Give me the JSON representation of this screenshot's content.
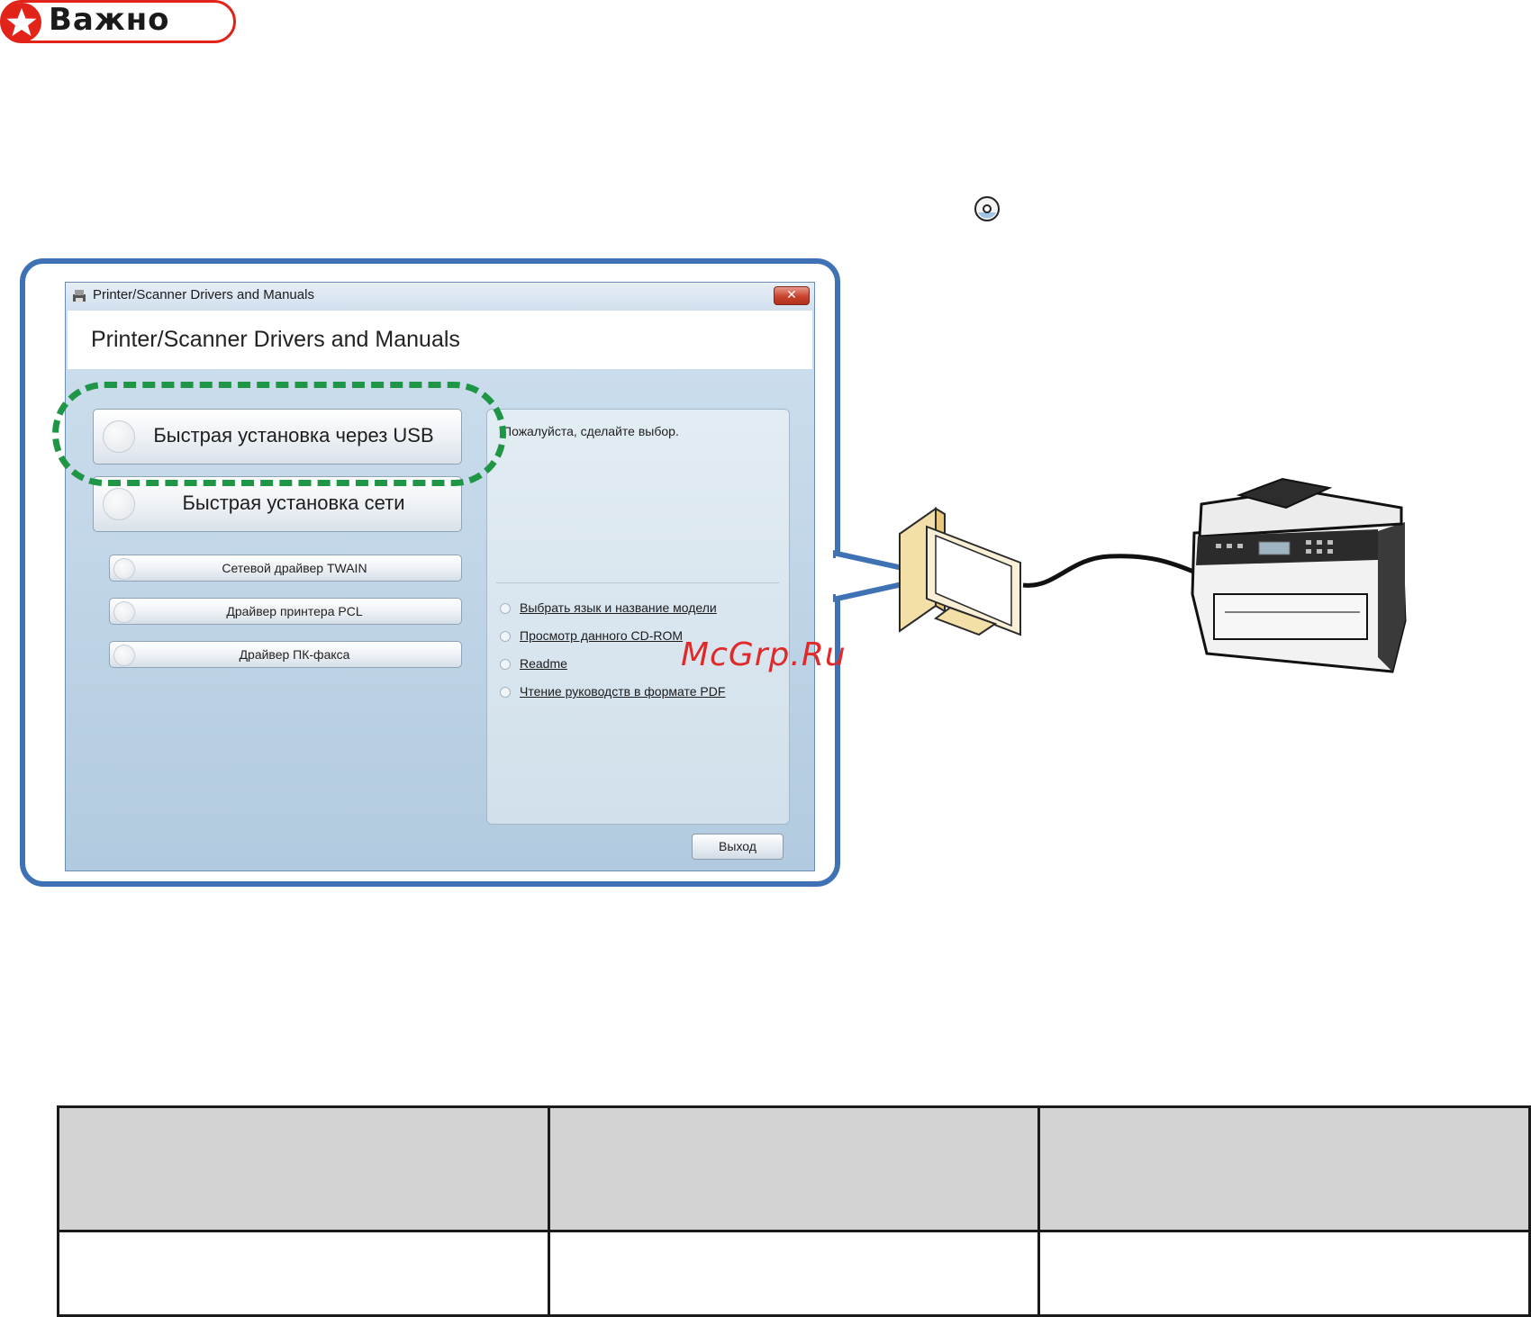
{
  "badge": {
    "label": "Важно"
  },
  "dialog": {
    "window_title": "Printer/Scanner Drivers and Manuals",
    "header_title": "Printer/Scanner Drivers and Manuals",
    "buttons": {
      "quick_usb": "Быстрая установка через USB",
      "quick_network": "Быстрая установка сети",
      "twain": "Сетевой драйвер TWAIN",
      "pcl": "Драйвер принтера PCL",
      "pc_fax": "Драйвер ПК-факса",
      "exit": "Выход"
    },
    "prompt": "Пожалуйста, сделайте выбор.",
    "links": [
      "Выбрать язык и название модели",
      "Просмотр данного CD-ROM",
      "Readme",
      "Чтение руководств в формате PDF"
    ]
  },
  "watermark": "McGrp.Ru",
  "colors": {
    "badge_red": "#e2231a",
    "callout_blue": "#3f72b5",
    "highlight_green": "#1e9646",
    "table_header_gray": "#d3d3d3"
  },
  "icons": [
    "star-icon",
    "cd-icon",
    "close-icon",
    "computer-illustration",
    "printer-illustration"
  ]
}
